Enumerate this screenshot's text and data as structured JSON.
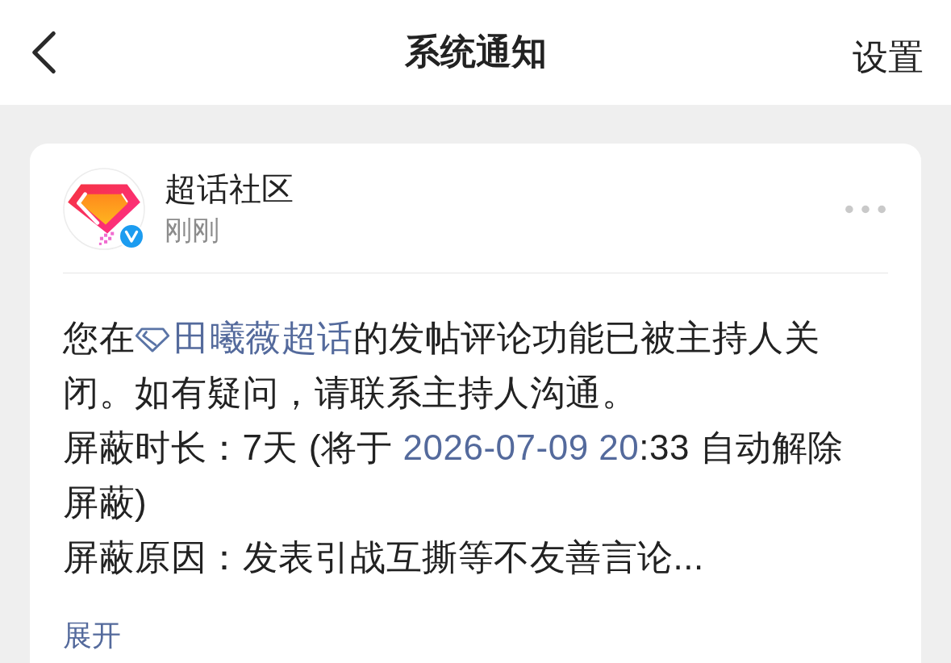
{
  "header": {
    "title": "系统通知",
    "action": "设置"
  },
  "notification": {
    "sender": {
      "name": "超话社区",
      "verified": true
    },
    "time": "刚刚",
    "paragraphs": [
      [
        {
          "kind": "text",
          "text": "您在"
        },
        {
          "kind": "topic",
          "text": "田曦薇超话"
        },
        {
          "kind": "text",
          "text": "的发帖评论功能已被主持人关闭。如有疑问，请联系主持人沟通。"
        }
      ],
      [
        {
          "kind": "text",
          "text": "屏蔽时长：7天 (将于 "
        },
        {
          "kind": "link",
          "text": "2026-07-09 20"
        },
        {
          "kind": "text",
          "text": ":33 自动解除屏蔽)"
        }
      ],
      [
        {
          "kind": "text",
          "text": "屏蔽原因：发表引战互撕等不友善言论..."
        }
      ]
    ],
    "expand_link": "展开"
  }
}
